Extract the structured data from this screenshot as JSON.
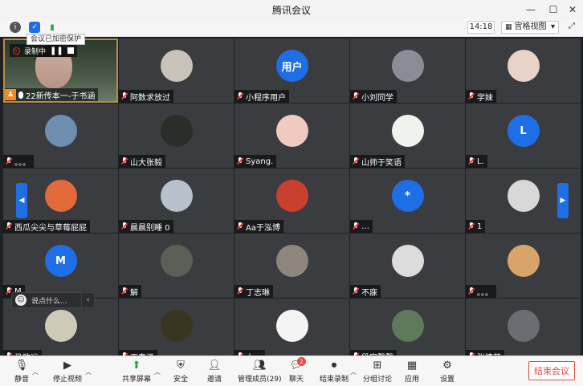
{
  "window": {
    "title": "腾讯会议",
    "minimize": "—",
    "maximize": "☐",
    "close": "✕"
  },
  "topbar": {
    "tooltip": "会议已加密保护",
    "clock": "14:18",
    "view_label": "宫格视图",
    "view_caret": "▾"
  },
  "self": {
    "recording_label": "录制中",
    "name": "22新传本一-于书涵"
  },
  "tiles": [
    {
      "name": "阿数求放过",
      "avatar_text": "",
      "avatar_color": "#c9c2b8"
    },
    {
      "name": "小程序用户",
      "avatar_text": "用户",
      "avatar_color": "#1e6fe6"
    },
    {
      "name": "小刘同学",
      "avatar_text": "",
      "avatar_color": "#8a8d96"
    },
    {
      "name": "学妹",
      "avatar_text": "",
      "avatar_color": "#e8d3c8"
    },
    {
      "name": "。。。",
      "avatar_text": "",
      "avatar_color": "#6f8fb0"
    },
    {
      "name": "山大张毅",
      "avatar_text": "",
      "avatar_color": "#2a2e2a"
    },
    {
      "name": "Syang.",
      "avatar_text": "",
      "avatar_color": "#f0c9c0"
    },
    {
      "name": "山师于笑语",
      "avatar_text": "",
      "avatar_color": "#eef3ee"
    },
    {
      "name": "L.",
      "avatar_text": "L",
      "avatar_color": "#1e6fe6"
    },
    {
      "name": "西瓜尖尖与草莓屁屁",
      "avatar_text": "",
      "avatar_color": "#e36a3a"
    },
    {
      "name": "晨晨别睡 0",
      "avatar_text": "",
      "avatar_color": "#b8c0cc"
    },
    {
      "name": "Aa于泓博",
      "avatar_text": "",
      "avatar_color": "#c9402e"
    },
    {
      "name": "…",
      "avatar_text": "*",
      "avatar_color": "#1e6fe6"
    },
    {
      "name": "1",
      "avatar_text": "",
      "avatar_color": "#d8d8d8"
    },
    {
      "name": "M",
      "avatar_text": "M",
      "avatar_color": "#1e6fe6"
    },
    {
      "name": "解",
      "avatar_text": "",
      "avatar_color": "#5b5f55"
    },
    {
      "name": "丁志琳",
      "avatar_text": "",
      "avatar_color": "#8e857c"
    },
    {
      "name": "不寐",
      "avatar_text": "",
      "avatar_color": "#dcdcdc"
    },
    {
      "name": "。。。",
      "avatar_text": "",
      "avatar_color": "#d9a46a"
    },
    {
      "name": "马致远",
      "avatar_text": "",
      "avatar_color": "#cfc9b8"
    },
    {
      "name": "王春泽",
      "avatar_text": "",
      "avatar_color": "#3a3520"
    },
    {
      "name": "大…",
      "avatar_text": "",
      "avatar_color": "#f4f4f4"
    },
    {
      "name": "段家馨馨",
      "avatar_text": "",
      "avatar_color": "#5e7a5a"
    },
    {
      "name": "张情萌",
      "avatar_text": "",
      "avatar_color": "#6a6e72"
    }
  ],
  "chat": {
    "placeholder": "说点什么...",
    "emoji": "☺",
    "collapse": "‹"
  },
  "nav": {
    "prev": "◀",
    "next": "▶"
  },
  "bottombar": {
    "mute": "静音",
    "stop_video": "停止视频",
    "share": "共享屏幕",
    "security": "安全",
    "invite": "邀请",
    "members": "管理成员(29)",
    "chat": "聊天",
    "chat_badge": "2",
    "record": "结束录制",
    "breakout": "分组讨论",
    "apps": "应用",
    "settings": "设置",
    "end": "结束会议"
  }
}
